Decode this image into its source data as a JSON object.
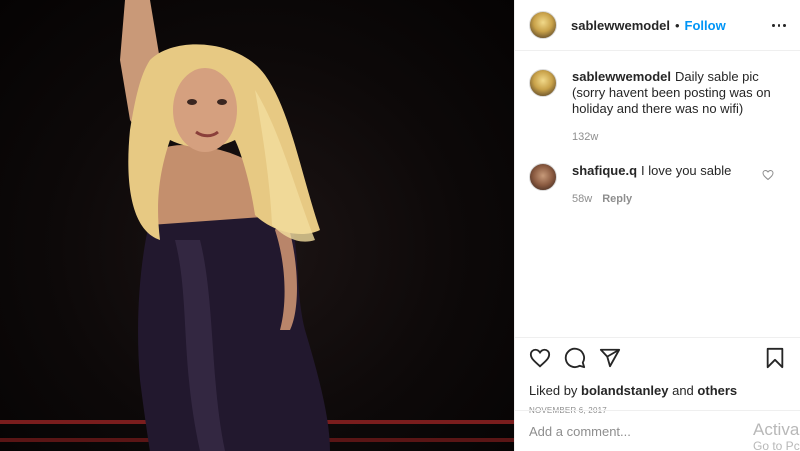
{
  "post": {
    "username": "sablewwemodel",
    "separator": "•",
    "follow_label": "Follow"
  },
  "comments": [
    {
      "username": "sablewwemodel",
      "text": "Daily sable pic (sorry havent been posting was on holiday and there was no wifi)",
      "time": "132w"
    },
    {
      "username": "shafique.q",
      "text": "I love you sable",
      "time": "58w",
      "reply_label": "Reply"
    }
  ],
  "likes": {
    "prefix": "Liked by",
    "user": "bolandstanley",
    "joiner": "and",
    "others": "others"
  },
  "date": "November 6, 2017",
  "add_comment": {
    "placeholder": "Add a comment..."
  },
  "watermark": {
    "line1": "Activa",
    "line2": "Go to Pc"
  },
  "colors": {
    "accent": "#0095f6",
    "muted": "#8e8e8e",
    "text": "#262626"
  },
  "icons": [
    "more-icon",
    "heart-icon",
    "comment-icon",
    "share-icon",
    "bookmark-icon"
  ]
}
